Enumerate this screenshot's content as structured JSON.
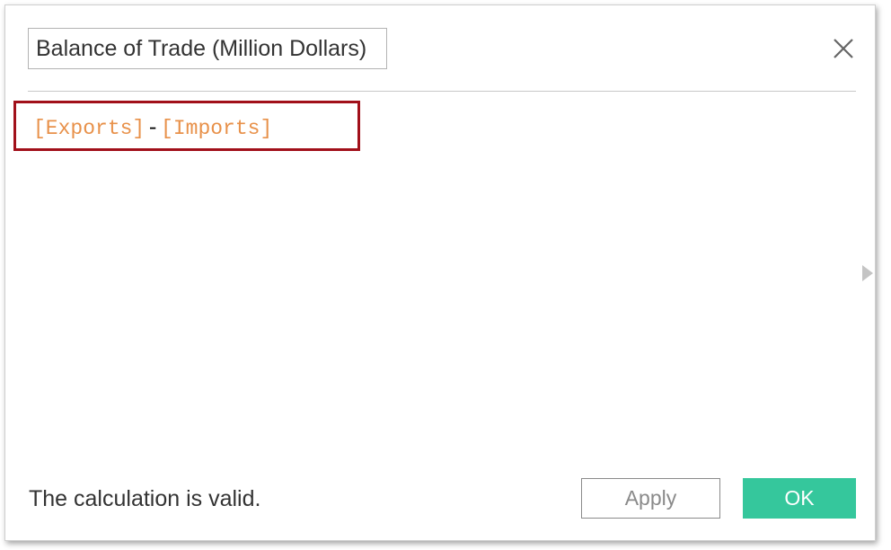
{
  "dialog": {
    "name_value": "Balance of Trade (Million Dollars)",
    "close_icon": "close-icon",
    "expand_icon": "chevron-right-icon"
  },
  "formula": {
    "left_field": "[Exports]",
    "operator": "-",
    "right_field": "[Imports]"
  },
  "status": {
    "message": "The calculation is valid."
  },
  "buttons": {
    "apply_label": "Apply",
    "ok_label": "OK"
  },
  "colors": {
    "field_reference": "#e8914a",
    "highlight_border": "#a1101a",
    "ok_button": "#35c79c"
  }
}
